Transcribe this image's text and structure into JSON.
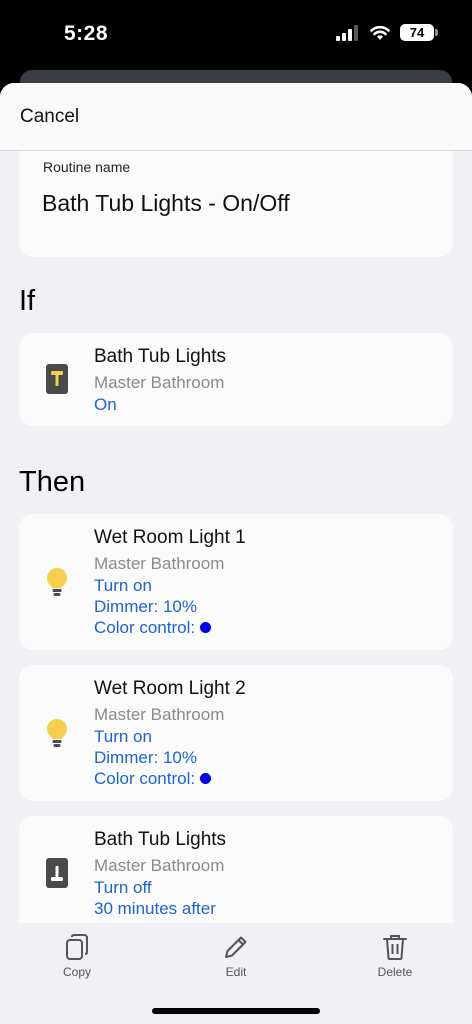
{
  "status": {
    "time": "5:28",
    "battery": "74"
  },
  "header": {
    "cancel_label": "Cancel"
  },
  "routine": {
    "name_label": "Routine name",
    "name_value": "Bath Tub Lights - On/Off"
  },
  "if_section": {
    "title": "If",
    "items": [
      {
        "title": "Bath Tub Lights",
        "room": "Master Bathroom",
        "lines": [
          "On"
        ],
        "icon": "switch-on-icon"
      }
    ]
  },
  "then_section": {
    "title": "Then",
    "items": [
      {
        "title": "Wet Room Light 1",
        "room": "Master Bathroom",
        "lines": [
          "Turn on",
          "Dimmer: 10%",
          "Color control:"
        ],
        "icon": "light-bulb-icon",
        "color_dot": "#0000ee"
      },
      {
        "title": "Wet Room Light 2",
        "room": "Master Bathroom",
        "lines": [
          "Turn on",
          "Dimmer: 10%",
          "Color control:"
        ],
        "icon": "light-bulb-icon",
        "color_dot": "#0000ee"
      },
      {
        "title": "Bath Tub Lights",
        "room": "Master Bathroom",
        "lines": [
          "Turn off",
          "30 minutes after"
        ],
        "icon": "switch-off-icon"
      }
    ]
  },
  "toolbar": {
    "copy_label": "Copy",
    "edit_label": "Edit",
    "delete_label": "Delete"
  },
  "colors": {
    "link": "#1c64d4",
    "bulb": "#f6d04d",
    "switch_body": "#4a4a4a",
    "switch_on": "#f6d04d"
  }
}
